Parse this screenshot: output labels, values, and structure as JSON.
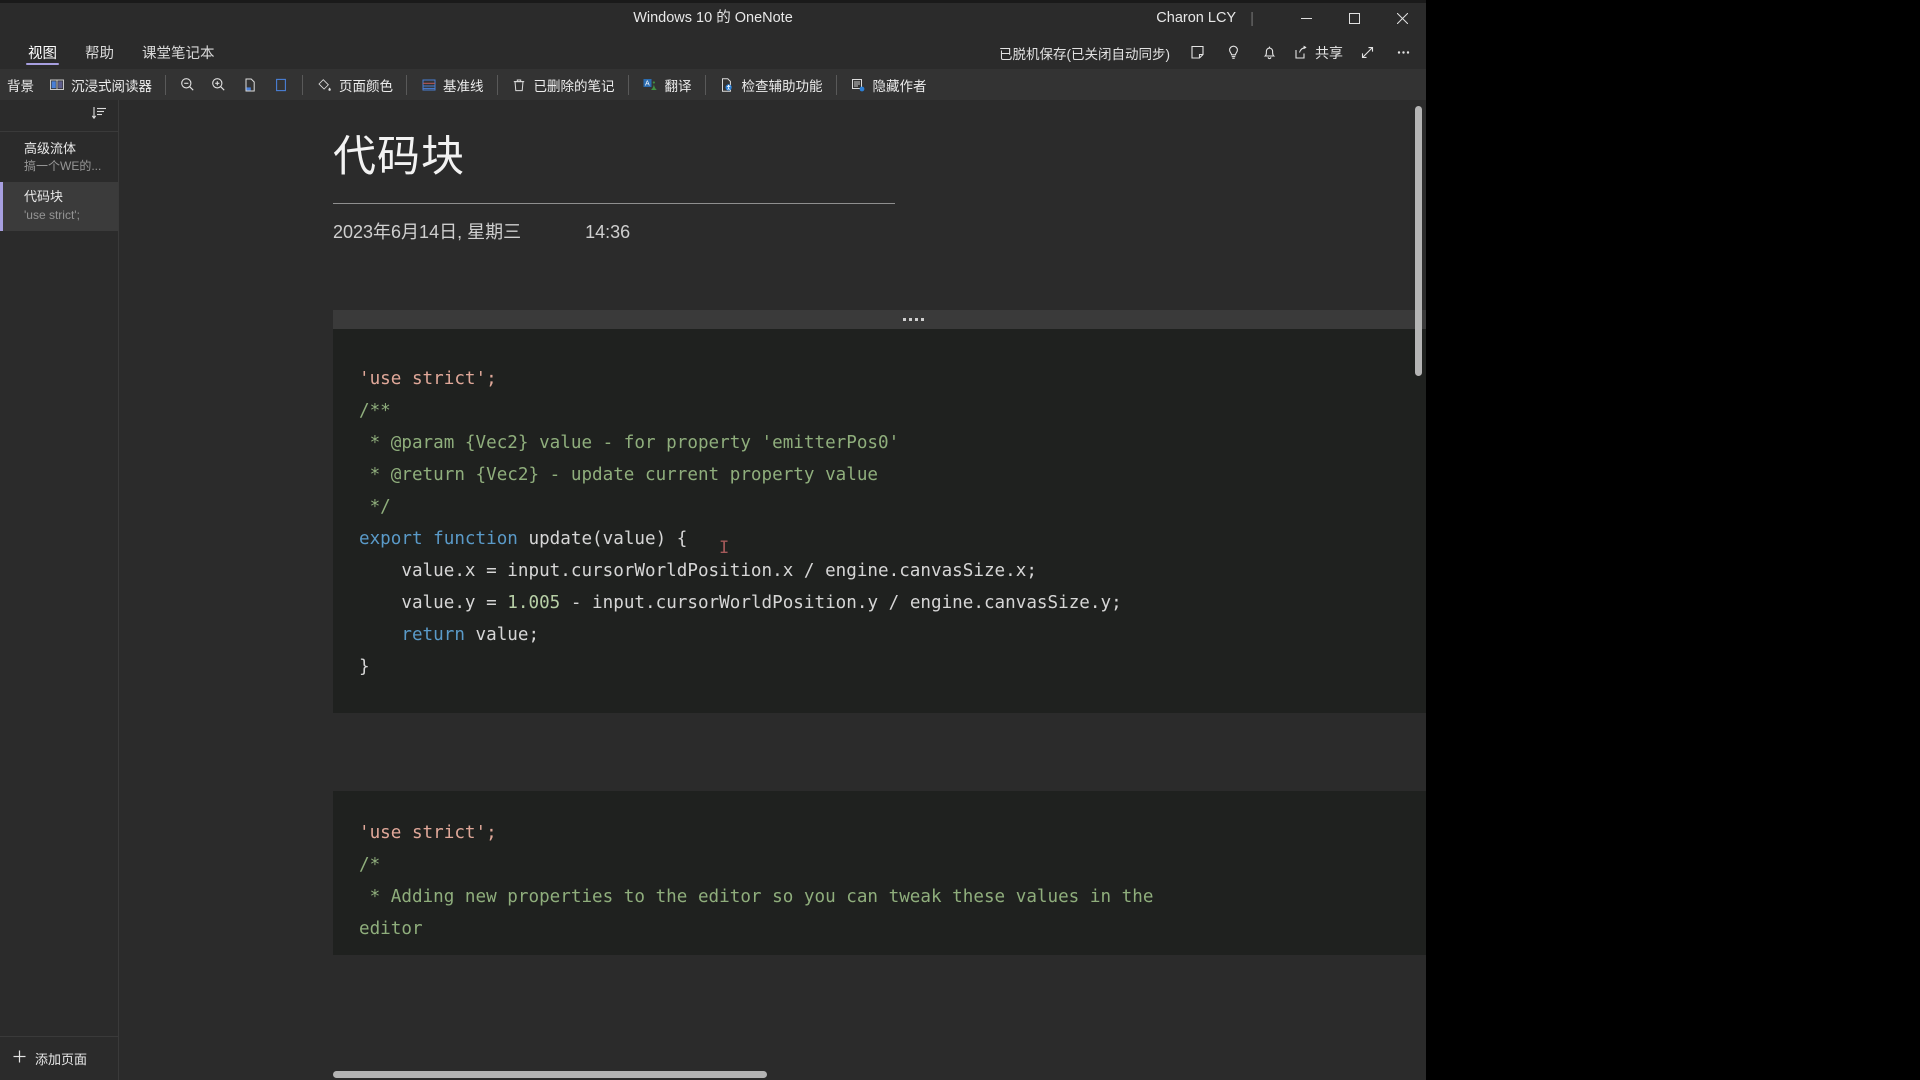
{
  "window": {
    "title": "Windows 10 的 OneNote",
    "account_name": "Charon LCY",
    "account_separator": "|",
    "minimize_label": "最小化",
    "maximize_label": "最大化",
    "close_label": "关闭"
  },
  "tabs": [
    {
      "label": "视图",
      "active": true
    },
    {
      "label": "帮助",
      "active": false
    },
    {
      "label": "课堂笔记本",
      "active": false
    }
  ],
  "header_tools": {
    "offline_status": "已脱机保存(已关闭自动同步)",
    "share_label": "共享",
    "sticky_note_icon": "sticky-note-icon",
    "lightbulb_icon": "lightbulb-icon",
    "bell_icon": "bell-icon",
    "share_icon": "share-icon",
    "fullscreen_icon": "expand-arrows-icon",
    "more_icon": "ellipsis-icon"
  },
  "ribbon": [
    {
      "label": "背景",
      "icon": "page-background-icon",
      "truncated": true
    },
    {
      "label": "沉浸式阅读器",
      "icon": "immersive-reader-icon"
    },
    {
      "sep": true
    },
    {
      "label": "",
      "icon": "zoom-out-icon"
    },
    {
      "label": "",
      "icon": "zoom-in-icon"
    },
    {
      "label": "",
      "icon": "page-width-icon"
    },
    {
      "label": "",
      "icon": "whole-page-icon"
    },
    {
      "sep": true
    },
    {
      "label": "页面颜色",
      "icon": "page-color-icon"
    },
    {
      "sep": true
    },
    {
      "label": "基准线",
      "icon": "rule-lines-icon"
    },
    {
      "sep": true
    },
    {
      "label": "已删除的笔记",
      "icon": "trash-icon"
    },
    {
      "sep": true
    },
    {
      "label": "翻译",
      "icon": "translate-icon"
    },
    {
      "sep": true
    },
    {
      "label": "检查辅助功能",
      "icon": "accessibility-check-icon"
    },
    {
      "sep": true
    },
    {
      "label": "隐藏作者",
      "icon": "hide-authors-icon"
    }
  ],
  "sidebar": {
    "sort_icon": "sort-pages-icon",
    "pages": [
      {
        "title": "高级流体",
        "subtitle": "搞一个WE的...",
        "selected": false
      },
      {
        "title": "代码块",
        "subtitle": "'use strict';",
        "selected": true
      }
    ],
    "add_page_label": "添加页面",
    "add_page_icon": "plus-icon"
  },
  "note": {
    "title": "代码块",
    "date": "2023年6月14日, 星期三",
    "time": "14:36"
  },
  "code_blocks": [
    {
      "id": "code-block-1",
      "handle_icon": "drag-handle-dots-icon",
      "prev_icon": "arrow-left-icon",
      "next_icon": "arrow-right-icon",
      "lines": [
        [
          {
            "t": "'use strict';",
            "c": "str"
          }
        ],
        [
          {
            "t": "/**",
            "c": "com"
          }
        ],
        [
          {
            "t": " * @param {Vec2} value - for property 'emitterPos0'",
            "c": "com"
          }
        ],
        [
          {
            "t": " * @return {Vec2} - update current property value",
            "c": "com"
          }
        ],
        [
          {
            "t": " */",
            "c": "com"
          }
        ],
        [
          {
            "t": "export function",
            "c": "kw"
          },
          {
            "t": " update(value) {",
            "c": "pln"
          }
        ],
        [
          {
            "t": "    value.x = input.cursorWorldPosition.x / engine.canvasSize.x;",
            "c": "pln"
          }
        ],
        [
          {
            "t": "    value.y = ",
            "c": "pln"
          },
          {
            "t": "1.005",
            "c": "num"
          },
          {
            "t": " - input.cursorWorldPosition.y / engine.canvasSize.y;",
            "c": "pln"
          }
        ],
        [
          {
            "t": "    ",
            "c": "pln"
          },
          {
            "t": "return",
            "c": "kw"
          },
          {
            "t": " value;",
            "c": "pln"
          }
        ],
        [
          {
            "t": "}",
            "c": "pln"
          }
        ]
      ]
    },
    {
      "id": "code-block-2",
      "handle_icon": "drag-handle-dots-icon",
      "prev_icon": "arrow-left-icon",
      "next_icon": "arrow-right-icon",
      "lines": [
        [
          {
            "t": "'use strict';",
            "c": "str"
          }
        ],
        [
          {
            "t": "/*",
            "c": "com"
          }
        ],
        [
          {
            "t": " * Adding new properties to the editor so you can tweak these values in the",
            "c": "com"
          }
        ],
        [
          {
            "t": "editor",
            "c": "com"
          }
        ]
      ]
    }
  ],
  "scrollbars": {
    "vertical": "vertical-scrollbar",
    "horizontal": "horizontal-scrollbar"
  },
  "cursor": {
    "glyph": "I",
    "name": "text-cursor"
  },
  "colors": {
    "accent": "#a79fe0",
    "window_bg": "#2b2b2b",
    "ribbon_bg": "#333333",
    "code_bg": "#1f211f",
    "string": "#e0a899",
    "comment": "#8fae7c",
    "keyword": "#5a9ac8",
    "number": "#b7cfa6"
  }
}
